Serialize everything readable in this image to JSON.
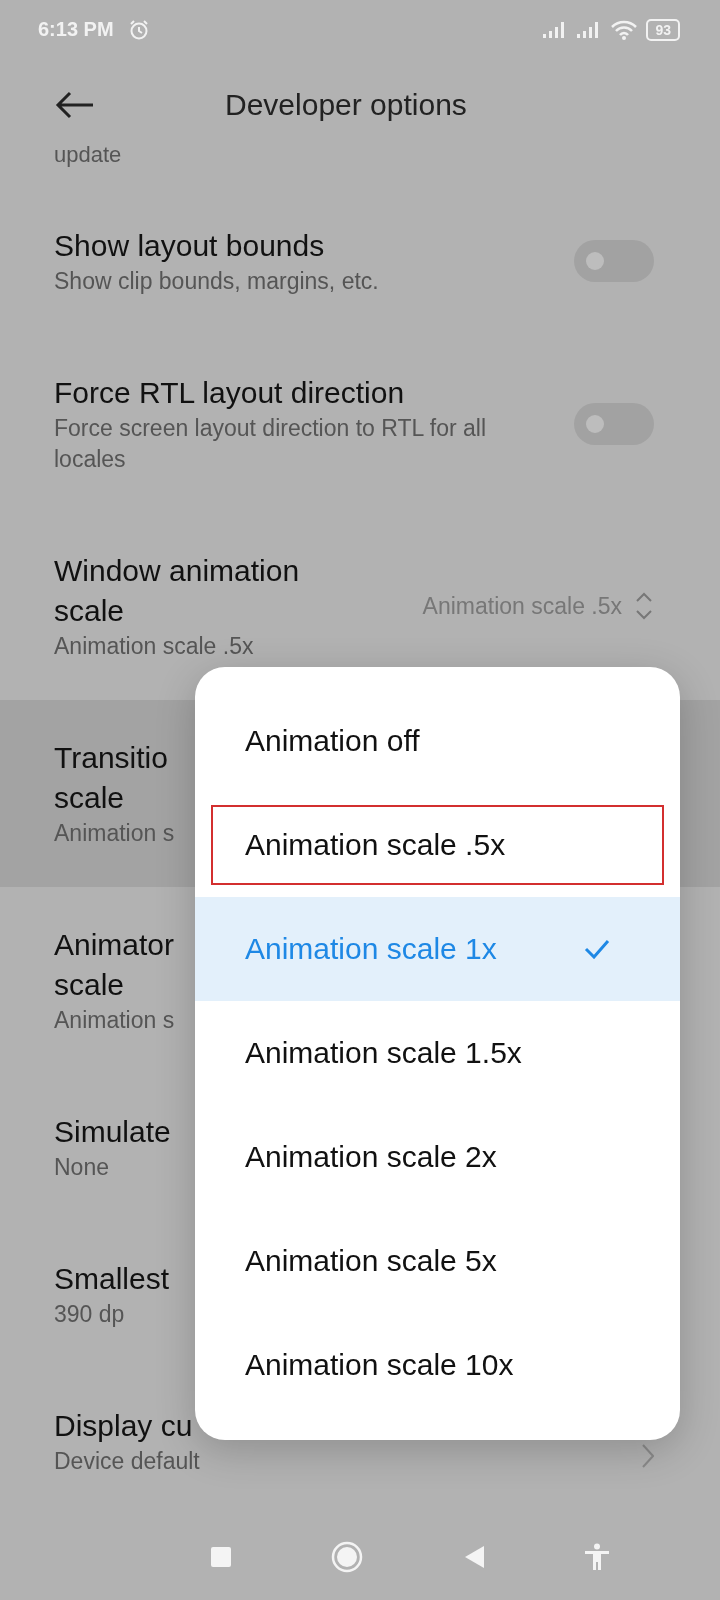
{
  "status_bar": {
    "time": "6:13 PM",
    "alarm": true,
    "battery": "93"
  },
  "header": {
    "title": "Developer options"
  },
  "partial_text": "update",
  "settings": [
    {
      "kind": "toggle",
      "title": "Show layout bounds",
      "subtitle": "Show clip bounds, margins, etc.",
      "on": false,
      "pressed": false
    },
    {
      "kind": "toggle",
      "title": "Force RTL layout direction",
      "subtitle": "Force screen layout direction to RTL for all locales",
      "on": false,
      "pressed": false
    },
    {
      "kind": "picker",
      "title": "Window animation scale",
      "subtitle": "Animation scale .5x",
      "value": "Animation scale .5x",
      "pressed": false
    },
    {
      "kind": "plain",
      "title": "Transitio\nscale",
      "subtitle": "Animation s",
      "pressed": true
    },
    {
      "kind": "plain",
      "title": "Animator\nscale",
      "subtitle": "Animation s",
      "pressed": false
    },
    {
      "kind": "plain",
      "title": "Simulate",
      "subtitle": "None",
      "pressed": false
    },
    {
      "kind": "plain",
      "title": "Smallest",
      "subtitle": "390 dp",
      "pressed": false
    },
    {
      "kind": "chevron",
      "title": "Display cu",
      "subtitle": "Device default",
      "pressed": false
    }
  ],
  "popup": {
    "options": [
      {
        "label": "Animation off",
        "selected": false,
        "outlined": false
      },
      {
        "label": "Animation scale .5x",
        "selected": false,
        "outlined": true
      },
      {
        "label": "Animation scale 1x",
        "selected": true,
        "outlined": false
      },
      {
        "label": "Animation scale 1.5x",
        "selected": false,
        "outlined": false
      },
      {
        "label": "Animation scale 2x",
        "selected": false,
        "outlined": false
      },
      {
        "label": "Animation scale 5x",
        "selected": false,
        "outlined": false
      },
      {
        "label": "Animation scale 10x",
        "selected": false,
        "outlined": false
      }
    ]
  }
}
